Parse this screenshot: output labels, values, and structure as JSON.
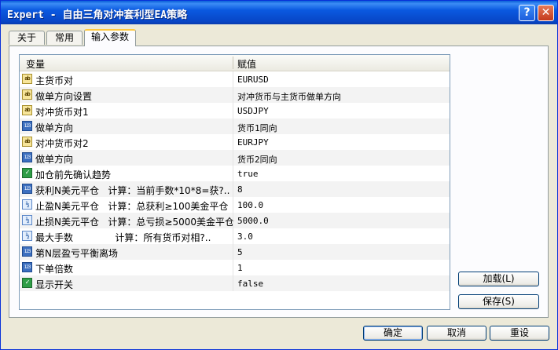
{
  "window": {
    "title": "Expert - 自由三角对冲套利型EA策略"
  },
  "title_buttons": {
    "help": "?",
    "close": "✕"
  },
  "tabs": [
    {
      "label": "关于"
    },
    {
      "label": "常用"
    },
    {
      "label": "输入参数"
    }
  ],
  "table": {
    "headers": {
      "variable": "变量",
      "value": "赋值"
    },
    "rows": [
      {
        "type": "ab",
        "name": "主货币对",
        "value": "EURUSD"
      },
      {
        "type": "ab",
        "name": "做单方向设置",
        "value": "对冲货币与主货币做单方向"
      },
      {
        "type": "ab",
        "name": "对冲货币对1",
        "value": "USDJPY"
      },
      {
        "type": "123",
        "name": "做单方向",
        "value": "货币1同向"
      },
      {
        "type": "ab",
        "name": "对冲货币对2",
        "value": "EURJPY"
      },
      {
        "type": "123",
        "name": "做单方向",
        "value": "货币2同向"
      },
      {
        "type": "bool",
        "name": "加仓前先确认趋势",
        "value": "true"
      },
      {
        "type": "123",
        "name": "获利N美元平仓   计算：当前手数*10*8=获?..",
        "value": "8"
      },
      {
        "type": "v2",
        "name": "止盈N美元平仓   计算：总获利≥100美金平仓",
        "value": "100.0"
      },
      {
        "type": "v2",
        "name": "止损N美元平仓   计算：总亏损≥5000美金平仓",
        "value": "5000.0"
      },
      {
        "type": "v2",
        "name": "最大手数              计算：所有货币对相?..",
        "value": "3.0"
      },
      {
        "type": "123",
        "name": "第N层盈亏平衡离场",
        "value": "5"
      },
      {
        "type": "123",
        "name": "下单倍数",
        "value": "1"
      },
      {
        "type": "bool",
        "name": "显示开关",
        "value": "false"
      }
    ]
  },
  "side_buttons": {
    "load": "加载(L)",
    "save": "保存(S)"
  },
  "footer_buttons": {
    "ok": "确定",
    "cancel": "取消",
    "reset": "重设"
  },
  "type_icons": {
    "ab": "ab",
    "123": "123",
    "bool": "✓",
    "v2": "½"
  }
}
